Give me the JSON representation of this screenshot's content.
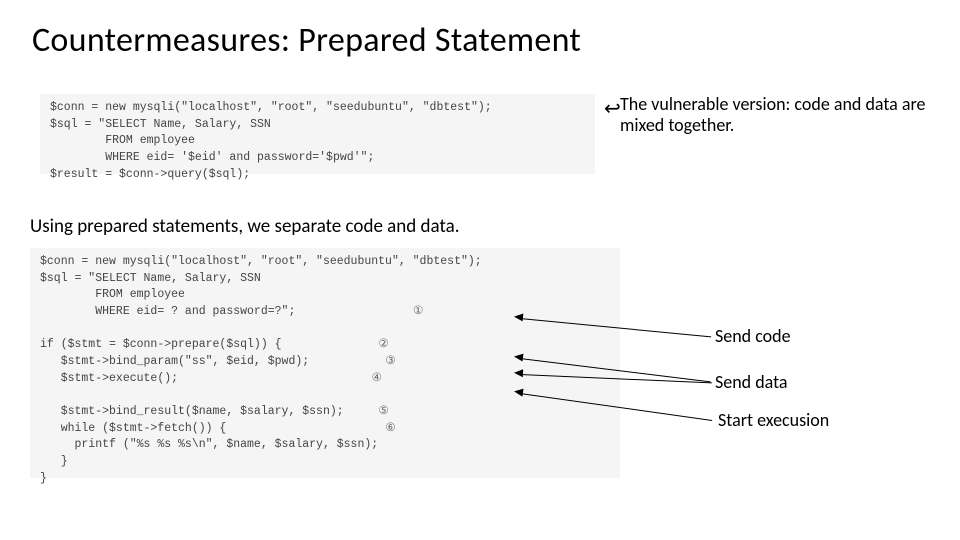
{
  "title": "Countermeasures: Prepared Statement",
  "code1": {
    "l1": "$conn = new mysqli(\"localhost\", \"root\", \"seedubuntu\", \"dbtest\");",
    "l2": "$sql = \"SELECT Name, Salary, SSN",
    "l3": "        FROM employee",
    "l4": "        WHERE eid= '$eid' and password='$pwd'\";",
    "l5": "$result = $conn->query($sql);"
  },
  "annotation1": "The vulnerable version: code and data are mixed together.",
  "subheading": "Using prepared statements, we separate code and data.",
  "code2": {
    "l1": "$conn = new mysqli(\"localhost\", \"root\", \"seedubuntu\", \"dbtest\");",
    "l2": "$sql = \"SELECT Name, Salary, SSN",
    "l3": "        FROM employee",
    "l4": "        WHERE eid= ? and password=?\";",
    "l5": "",
    "l6": "if ($stmt = $conn->prepare($sql)) {",
    "l7": "   $stmt->bind_param(\"ss\", $eid, $pwd);",
    "l8": "   $stmt->execute();",
    "l9": "",
    "l10": "   $stmt->bind_result($name, $salary, $ssn);",
    "l11": "   while ($stmt->fetch()) {",
    "l12": "     printf (\"%s %s %s\\n\", $name, $salary, $ssn);",
    "l13": "   }",
    "l14": "}"
  },
  "markers": {
    "m1": "①",
    "m2": "②",
    "m3": "③",
    "m4": "④",
    "m5": "⑤",
    "m6": "⑥"
  },
  "labels": {
    "send_code": "Send code",
    "send_data": "Send data",
    "start_exec": "Start execusion"
  }
}
